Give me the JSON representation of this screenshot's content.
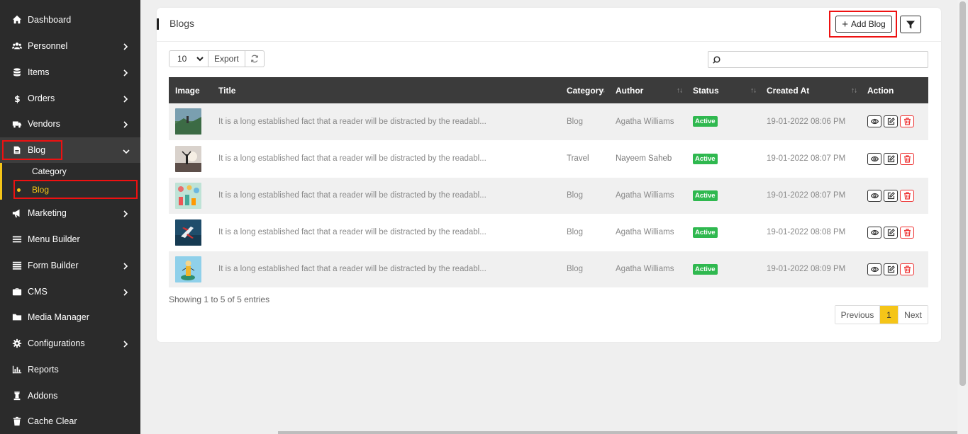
{
  "sidebar": {
    "items": [
      {
        "label": "Dashboard",
        "icon": "home-icon",
        "chevron": false
      },
      {
        "label": "Personnel",
        "icon": "users-icon",
        "chevron": true
      },
      {
        "label": "Items",
        "icon": "database-icon",
        "chevron": true
      },
      {
        "label": "Orders",
        "icon": "dollar-icon",
        "chevron": true
      },
      {
        "label": "Vendors",
        "icon": "truck-icon",
        "chevron": true
      },
      {
        "label": "Blog",
        "icon": "blog-icon",
        "chevron": true,
        "expanded": true
      },
      {
        "label": "Marketing",
        "icon": "megaphone-icon",
        "chevron": true
      },
      {
        "label": "Menu Builder",
        "icon": "bars-icon",
        "chevron": false
      },
      {
        "label": "Form Builder",
        "icon": "list-icon",
        "chevron": true
      },
      {
        "label": "CMS",
        "icon": "briefcase-icon",
        "chevron": true
      },
      {
        "label": "Media Manager",
        "icon": "folder-icon",
        "chevron": false
      },
      {
        "label": "Configurations",
        "icon": "gear-icon",
        "chevron": true
      },
      {
        "label": "Reports",
        "icon": "chart-icon",
        "chevron": false
      },
      {
        "label": "Addons",
        "icon": "chess-icon",
        "chevron": false
      },
      {
        "label": "Cache Clear",
        "icon": "trash-icon",
        "chevron": false
      }
    ],
    "blog_sub": {
      "category": "Category",
      "blog": "Blog"
    }
  },
  "header": {
    "title": "Blogs",
    "add_label": "Add Blog"
  },
  "toolbar": {
    "page_size": "10",
    "export_label": "Export"
  },
  "table": {
    "columns": [
      "Image",
      "Title",
      "Category",
      "Author",
      "Status",
      "Created At",
      "Action"
    ],
    "rows": [
      {
        "title": "It is a long established fact that a reader will be distracted by the readabl...",
        "category": "Blog",
        "author": "Agatha Williams",
        "status": "Active",
        "created": "19-01-2022 08:06 PM"
      },
      {
        "title": "It is a long established fact that a reader will be distracted by the readabl...",
        "category": "Travel",
        "author": "Nayeem Saheb",
        "status": "Active",
        "created": "19-01-2022 08:07 PM"
      },
      {
        "title": "It is a long established fact that a reader will be distracted by the readabl...",
        "category": "Blog",
        "author": "Agatha Williams",
        "status": "Active",
        "created": "19-01-2022 08:07 PM"
      },
      {
        "title": "It is a long established fact that a reader will be distracted by the readabl...",
        "category": "Blog",
        "author": "Agatha Williams",
        "status": "Active",
        "created": "19-01-2022 08:08 PM"
      },
      {
        "title": "It is a long established fact that a reader will be distracted by the readabl...",
        "category": "Blog",
        "author": "Agatha Williams",
        "status": "Active",
        "created": "19-01-2022 08:09 PM"
      }
    ]
  },
  "footer": {
    "info": "Showing 1 to 5 of 5 entries",
    "previous": "Previous",
    "current_page": "1",
    "next": "Next"
  },
  "colors": {
    "sidebar_bg": "#2b2b2b",
    "accent": "#f5c518",
    "active_badge": "#2fb84f",
    "highlight_box": "#ee1111"
  }
}
